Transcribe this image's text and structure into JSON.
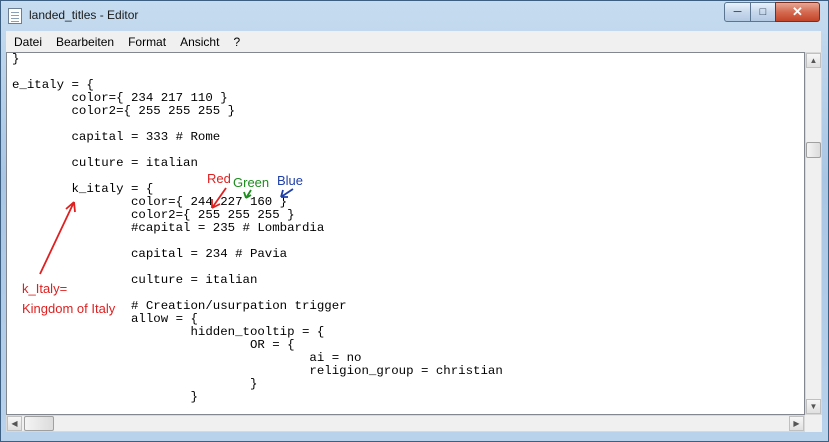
{
  "window": {
    "title": "landed_titles - Editor",
    "buttons": {
      "minimize": "─",
      "maximize": "□",
      "close": "✕"
    }
  },
  "menu": {
    "items": [
      "Datei",
      "Bearbeiten",
      "Format",
      "Ansicht",
      "?"
    ]
  },
  "editor": {
    "lines": [
      "}",
      "",
      "e_italy = {",
      "        color={ 234 217 110 }",
      "        color2={ 255 255 255 }",
      "",
      "        capital = 333 # Rome",
      "",
      "        culture = italian",
      "",
      "        k_italy = {",
      "                color={ 244 227 160 }",
      "                color2={ 255 255 255 }",
      "                #capital = 235 # Lombardia",
      "",
      "                capital = 234 # Pavia",
      "",
      "                culture = italian",
      "",
      "                # Creation/usurpation trigger",
      "                allow = {",
      "                        hidden_tooltip = {",
      "                                OR = {",
      "                                        ai = no",
      "                                        religion_group = christian",
      "                                }",
      "                        }"
    ]
  },
  "annotations": {
    "red_label": "Red",
    "green_label": "Green",
    "blue_label": "Blue",
    "k_italy_note_line1": "k_Italy=",
    "k_italy_note_line2": "Kingdom of Italy",
    "colors": {
      "red": "#e02020",
      "green": "#1e8c1e",
      "blue": "#1f3fa8"
    }
  },
  "scrollbars": {
    "vertical": {
      "up_icon": "scroll-up-arrow",
      "down_icon": "scroll-down-arrow"
    },
    "horizontal": {
      "left_icon": "scroll-left-arrow",
      "right_icon": "scroll-right-arrow"
    }
  }
}
